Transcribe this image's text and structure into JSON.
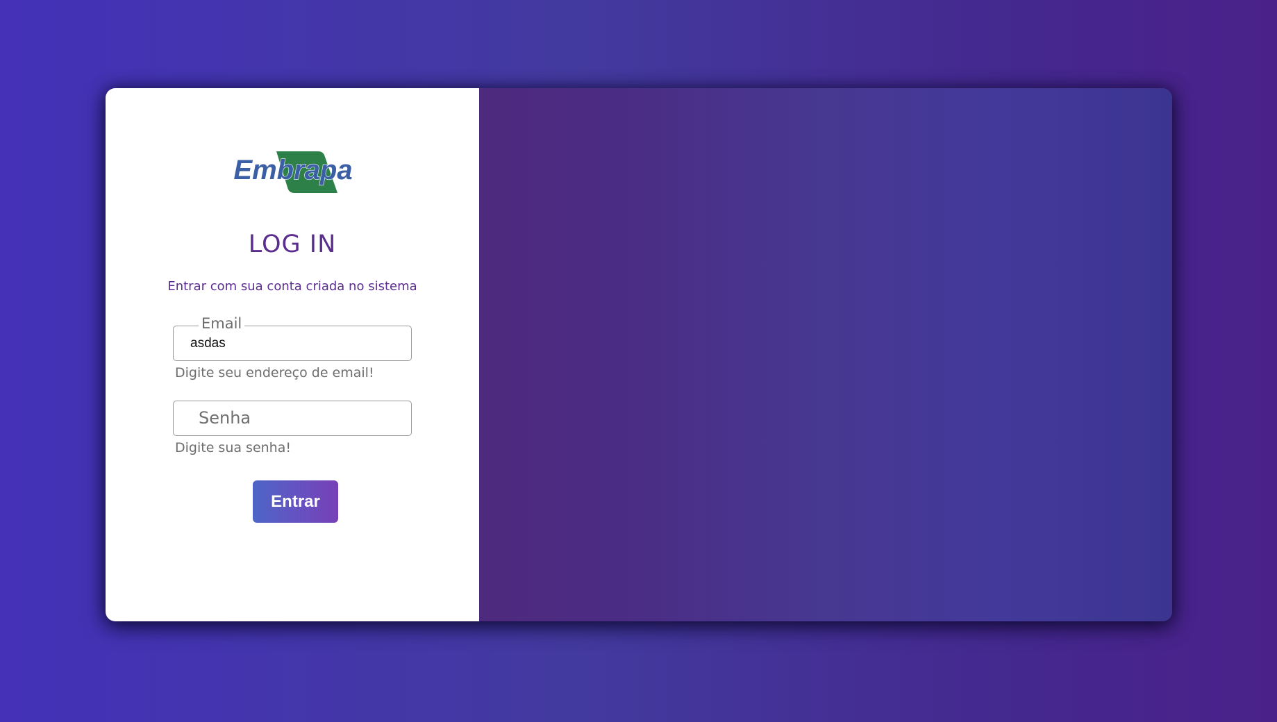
{
  "logo": {
    "text": "Embrapa",
    "colors": {
      "text": "#3a5fa5",
      "leaf": "#2e8049"
    }
  },
  "login": {
    "title": "LOG IN",
    "subtitle": "Entrar com sua conta criada no sistema"
  },
  "email": {
    "label": "Email",
    "value": "asdas",
    "helper": "Digite seu endereço de email!"
  },
  "senha": {
    "placeholder": "Senha",
    "helper": "Digite sua senha!"
  },
  "button": {
    "label": "Entrar"
  },
  "colors": {
    "accent": "#5a2d8f",
    "button_start": "#4d65c6",
    "button_end": "#7740b6"
  }
}
